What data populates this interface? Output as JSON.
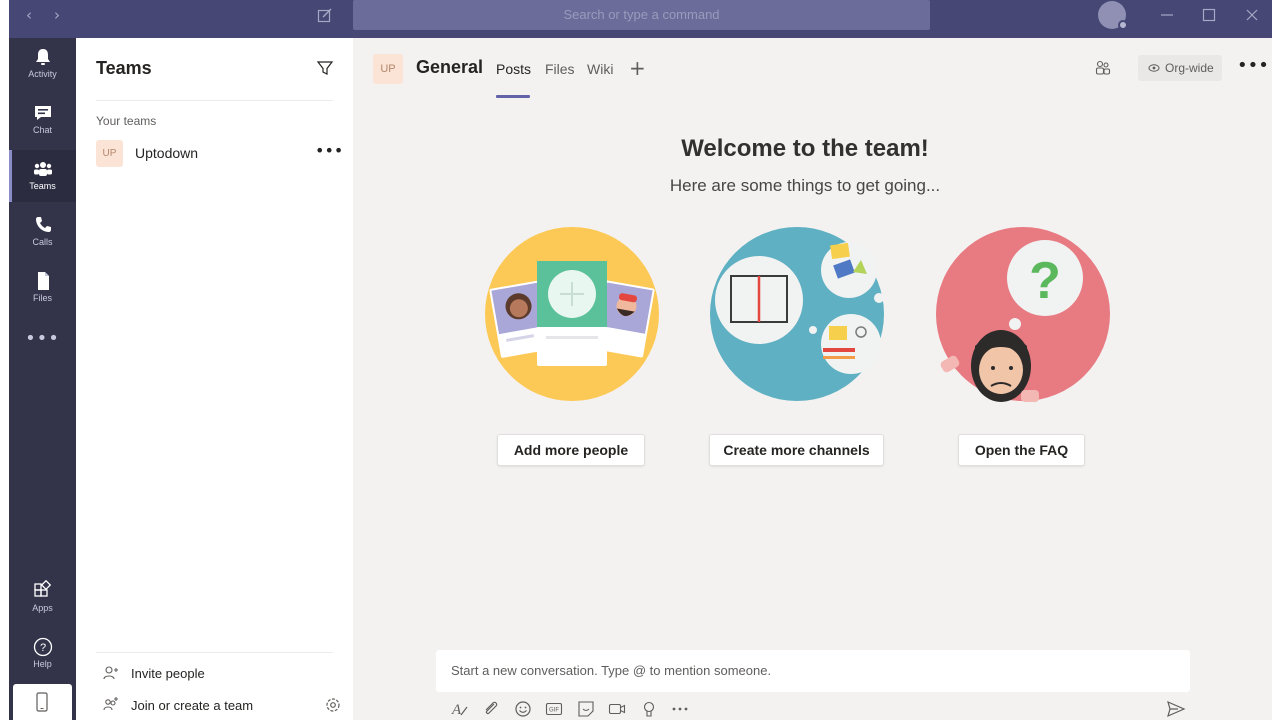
{
  "titlebar": {
    "search_placeholder": "Search or type a command"
  },
  "rail": {
    "items": [
      {
        "label": "Activity",
        "icon": "bell-icon"
      },
      {
        "label": "Chat",
        "icon": "chat-icon"
      },
      {
        "label": "Teams",
        "icon": "teams-icon"
      },
      {
        "label": "Calls",
        "icon": "phone-icon"
      },
      {
        "label": "Files",
        "icon": "file-icon"
      }
    ],
    "more": "•••",
    "bottom": [
      {
        "label": "Apps",
        "icon": "apps-icon"
      },
      {
        "label": "Help",
        "icon": "help-icon"
      }
    ]
  },
  "panel": {
    "title": "Teams",
    "section": "Your teams",
    "teams": [
      {
        "initials": "UP",
        "name": "Uptodown"
      }
    ],
    "more": "•••",
    "invite": "Invite people",
    "join": "Join or create a team"
  },
  "header": {
    "avatar": "UP",
    "channel": "General",
    "tabs": [
      "Posts",
      "Files",
      "Wiki"
    ],
    "plus": "+",
    "org": "Org-wide",
    "more": "•••"
  },
  "welcome": {
    "title": "Welcome to the team!",
    "subtitle": "Here are some things to get going...",
    "actions": [
      "Add more people",
      "Create more channels",
      "Open the FAQ"
    ]
  },
  "compose": {
    "placeholder": "Start a new conversation. Type @ to mention someone."
  },
  "colors": {
    "accent": "#6264a7",
    "titlebar": "#464775",
    "rail": "#33344a"
  }
}
